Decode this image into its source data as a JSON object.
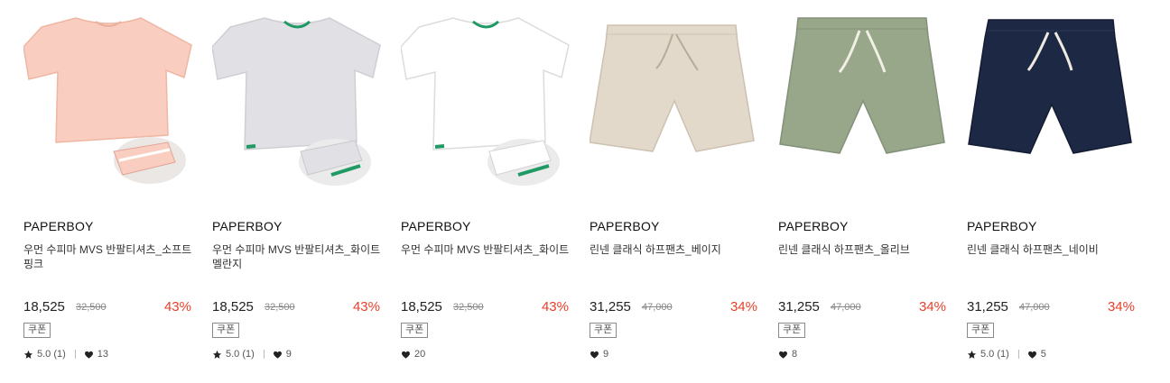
{
  "products": [
    {
      "brand": "PAPERBOY",
      "name": "우먼 수피마 MVS 반팔티셔츠_소프트핑크",
      "price": "18,525",
      "original_price": "32,500",
      "discount": "43%",
      "coupon": "쿠폰",
      "rating": "5.0 (1)",
      "likes": "13",
      "image": "tshirt-pink"
    },
    {
      "brand": "PAPERBOY",
      "name": "우먼 수피마 MVS 반팔티셔츠_화이트멜란지",
      "price": "18,525",
      "original_price": "32,500",
      "discount": "43%",
      "coupon": "쿠폰",
      "rating": "5.0 (1)",
      "likes": "9",
      "image": "tshirt-grey"
    },
    {
      "brand": "PAPERBOY",
      "name": "우먼 수피마 MVS 반팔티셔츠_화이트",
      "price": "18,525",
      "original_price": "32,500",
      "discount": "43%",
      "coupon": "쿠폰",
      "likes": "20",
      "image": "tshirt-white"
    },
    {
      "brand": "PAPERBOY",
      "name": "린넨 클래식 하프팬츠_베이지",
      "price": "31,255",
      "original_price": "47,000",
      "discount": "34%",
      "coupon": "쿠폰",
      "likes": "9",
      "image": "shorts-beige"
    },
    {
      "brand": "PAPERBOY",
      "name": "린넨 클래식 하프팬츠_올리브",
      "price": "31,255",
      "original_price": "47,000",
      "discount": "34%",
      "coupon": "쿠폰",
      "likes": "8",
      "image": "shorts-olive"
    },
    {
      "brand": "PAPERBOY",
      "name": "린넨 클래식 하프팬츠_네이비",
      "price": "31,255",
      "original_price": "47,000",
      "discount": "34%",
      "coupon": "쿠폰",
      "rating": "5.0 (1)",
      "likes": "5",
      "image": "shorts-navy"
    }
  ],
  "colors": {
    "discount": "#e8402a",
    "pink": "#f9cdbf",
    "grey": "#e1e0e4",
    "white": "#ffffff",
    "beige": "#e2d9cb",
    "olive": "#98a68a",
    "navy": "#1d2845",
    "trim_green": "#1f9a64"
  },
  "icons": {
    "rating": "star-icon",
    "likes": "heart-icon"
  }
}
